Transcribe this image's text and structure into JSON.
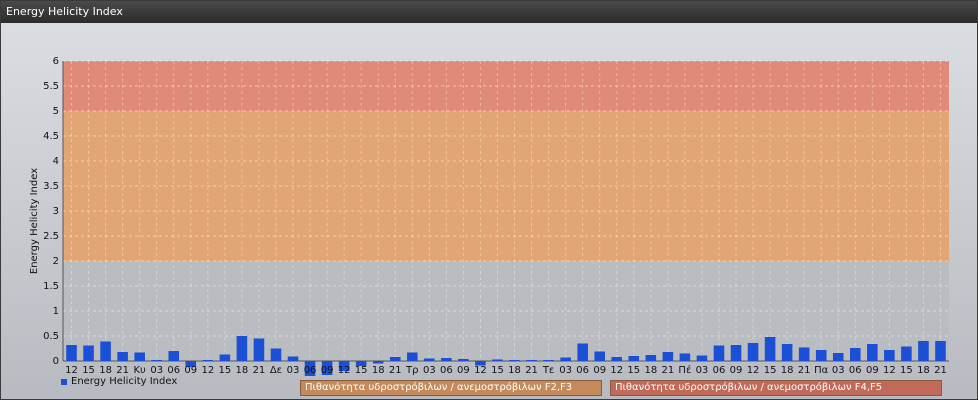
{
  "window": {
    "title": "Energy Helicity Index"
  },
  "chart_data": {
    "type": "bar",
    "ylabel": "Energy Helicity Index",
    "ylim": [
      0,
      6
    ],
    "yticks": [
      "0",
      "0.5",
      "1",
      "1.5",
      "2",
      "2.5",
      "3",
      "3.5",
      "4",
      "4.5",
      "5",
      "5.5",
      "6"
    ],
    "grid": true,
    "legend_position": "bottom-left",
    "bands": [
      {
        "from": 2,
        "to": 5,
        "color": "#e6a36c",
        "label": "Πιθανότητα υδροστρόβιλων / ανεμοστρόβιλων F2,F3"
      },
      {
        "from": 5,
        "to": 6,
        "color": "#e38570",
        "label": "Πιθανότητα υδροστρόβιλων / ανεμοστρόβιλων F4,F5"
      }
    ],
    "categories": [
      "12",
      "15",
      "18",
      "21",
      "Κυ",
      "03",
      "06",
      "09",
      "12",
      "15",
      "18",
      "21",
      "Δε",
      "03",
      "06",
      "09",
      "12",
      "15",
      "18",
      "21",
      "Τρ",
      "03",
      "06",
      "09",
      "12",
      "15",
      "18",
      "21",
      "Τε",
      "03",
      "06",
      "09",
      "12",
      "15",
      "18",
      "21",
      "Πέ",
      "03",
      "06",
      "09",
      "12",
      "15",
      "18",
      "21",
      "Πα",
      "03",
      "06",
      "09",
      "12",
      "15",
      "18",
      "21"
    ],
    "series": [
      {
        "name": "Energy Helicity Index",
        "color": "#1a4fd6",
        "values": [
          0.32,
          0.31,
          0.39,
          0.18,
          0.17,
          0.02,
          0.2,
          -0.12,
          0.02,
          0.13,
          0.5,
          0.45,
          0.25,
          0.09,
          -0.3,
          -0.28,
          -0.2,
          -0.1,
          -0.05,
          0.08,
          0.17,
          0.05,
          0.06,
          0.04,
          -0.09,
          0.03,
          0.02,
          0.02,
          0.02,
          0.07,
          0.35,
          0.19,
          0.08,
          0.1,
          0.12,
          0.18,
          0.15,
          0.11,
          0.31,
          0.32,
          0.36,
          0.48,
          0.34,
          0.27,
          0.22,
          0.16,
          0.26,
          0.34,
          0.22,
          0.29,
          0.4,
          0.4
        ]
      }
    ]
  }
}
